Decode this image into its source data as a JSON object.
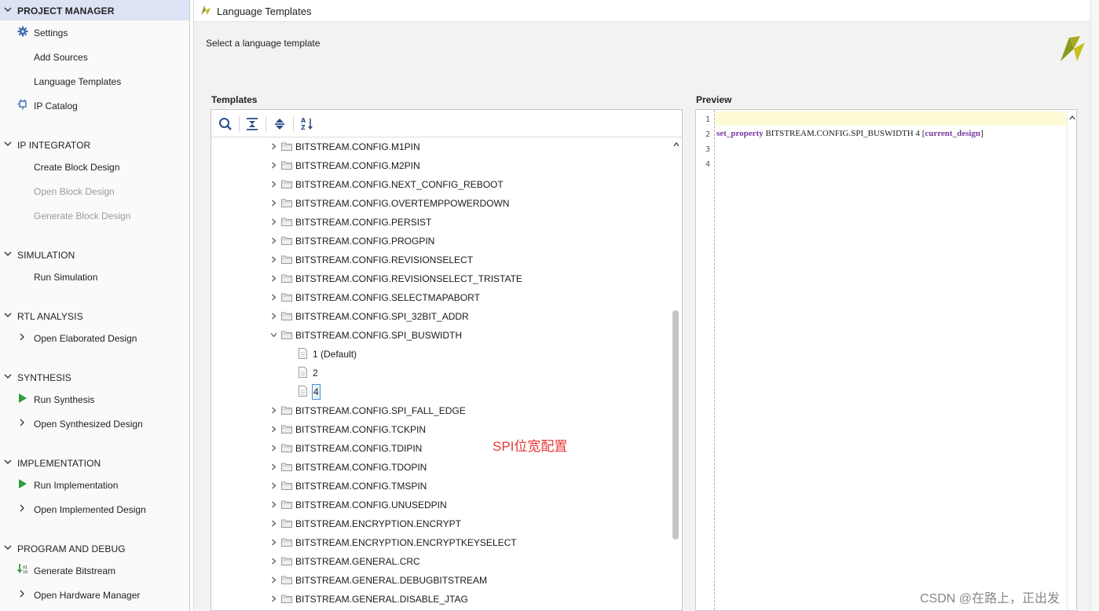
{
  "nav": {
    "sections": [
      {
        "title": "PROJECT MANAGER",
        "active": true,
        "items": [
          {
            "label": "Settings",
            "icon": "gear-icon",
            "disabled": false
          },
          {
            "label": "Add Sources",
            "icon": "",
            "disabled": false
          },
          {
            "label": "Language Templates",
            "icon": "",
            "disabled": false
          },
          {
            "label": "IP Catalog",
            "icon": "plug-icon",
            "disabled": false
          }
        ]
      },
      {
        "title": "IP INTEGRATOR",
        "active": false,
        "items": [
          {
            "label": "Create Block Design",
            "icon": "",
            "disabled": false
          },
          {
            "label": "Open Block Design",
            "icon": "",
            "disabled": true
          },
          {
            "label": "Generate Block Design",
            "icon": "",
            "disabled": true
          }
        ]
      },
      {
        "title": "SIMULATION",
        "active": false,
        "items": [
          {
            "label": "Run Simulation",
            "icon": "",
            "disabled": false
          }
        ]
      },
      {
        "title": "RTL ANALYSIS",
        "active": false,
        "items": [
          {
            "label": "Open Elaborated Design",
            "icon": "chevron-right-icon",
            "disabled": false
          }
        ]
      },
      {
        "title": "SYNTHESIS",
        "active": false,
        "items": [
          {
            "label": "Run Synthesis",
            "icon": "play-icon",
            "disabled": false
          },
          {
            "label": "Open Synthesized Design",
            "icon": "chevron-right-icon",
            "disabled": false
          }
        ]
      },
      {
        "title": "IMPLEMENTATION",
        "active": false,
        "items": [
          {
            "label": "Run Implementation",
            "icon": "play-icon",
            "disabled": false
          },
          {
            "label": "Open Implemented Design",
            "icon": "chevron-right-icon",
            "disabled": false
          }
        ]
      },
      {
        "title": "PROGRAM AND DEBUG",
        "active": false,
        "items": [
          {
            "label": "Generate Bitstream",
            "icon": "bitstream-icon",
            "disabled": false
          },
          {
            "label": "Open Hardware Manager",
            "icon": "chevron-right-icon",
            "disabled": false
          }
        ]
      }
    ]
  },
  "window": {
    "title": "Language Templates",
    "subtitle": "Select a language template"
  },
  "templates": {
    "label": "Templates",
    "toolbar": [
      "search-icon",
      "collapse-all-icon",
      "expand-all-icon",
      "sort-az-icon"
    ],
    "rows": [
      {
        "label": "BITSTREAM.CONFIG.M1PIN",
        "kind": "folder",
        "expanded": false
      },
      {
        "label": "BITSTREAM.CONFIG.M2PIN",
        "kind": "folder",
        "expanded": false
      },
      {
        "label": "BITSTREAM.CONFIG.NEXT_CONFIG_REBOOT",
        "kind": "folder",
        "expanded": false
      },
      {
        "label": "BITSTREAM.CONFIG.OVERTEMPPOWERDOWN",
        "kind": "folder",
        "expanded": false
      },
      {
        "label": "BITSTREAM.CONFIG.PERSIST",
        "kind": "folder",
        "expanded": false
      },
      {
        "label": "BITSTREAM.CONFIG.PROGPIN",
        "kind": "folder",
        "expanded": false
      },
      {
        "label": "BITSTREAM.CONFIG.REVISIONSELECT",
        "kind": "folder",
        "expanded": false
      },
      {
        "label": "BITSTREAM.CONFIG.REVISIONSELECT_TRISTATE",
        "kind": "folder",
        "expanded": false
      },
      {
        "label": "BITSTREAM.CONFIG.SELECTMAPABORT",
        "kind": "folder",
        "expanded": false
      },
      {
        "label": "BITSTREAM.CONFIG.SPI_32BIT_ADDR",
        "kind": "folder",
        "expanded": false
      },
      {
        "label": "BITSTREAM.CONFIG.SPI_BUSWIDTH",
        "kind": "folder",
        "expanded": true
      },
      {
        "label": "1 (Default)",
        "kind": "leaf",
        "selected": false
      },
      {
        "label": "2",
        "kind": "leaf",
        "selected": false
      },
      {
        "label": "4",
        "kind": "leaf",
        "selected": true
      },
      {
        "label": "BITSTREAM.CONFIG.SPI_FALL_EDGE",
        "kind": "folder",
        "expanded": false
      },
      {
        "label": "BITSTREAM.CONFIG.TCKPIN",
        "kind": "folder",
        "expanded": false
      },
      {
        "label": "BITSTREAM.CONFIG.TDIPIN",
        "kind": "folder",
        "expanded": false
      },
      {
        "label": "BITSTREAM.CONFIG.TDOPIN",
        "kind": "folder",
        "expanded": false
      },
      {
        "label": "BITSTREAM.CONFIG.TMSPIN",
        "kind": "folder",
        "expanded": false
      },
      {
        "label": "BITSTREAM.CONFIG.UNUSEDPIN",
        "kind": "folder",
        "expanded": false
      },
      {
        "label": "BITSTREAM.ENCRYPTION.ENCRYPT",
        "kind": "folder",
        "expanded": false
      },
      {
        "label": "BITSTREAM.ENCRYPTION.ENCRYPTKEYSELECT",
        "kind": "folder",
        "expanded": false
      },
      {
        "label": "BITSTREAM.GENERAL.CRC",
        "kind": "folder",
        "expanded": false
      },
      {
        "label": "BITSTREAM.GENERAL.DEBUGBITSTREAM",
        "kind": "folder",
        "expanded": false
      },
      {
        "label": "BITSTREAM.GENERAL.DISABLE_JTAG",
        "kind": "folder",
        "expanded": false
      }
    ],
    "annotation": "SPI位宽配置"
  },
  "preview": {
    "label": "Preview",
    "line_numbers": [
      "1",
      "2",
      "3",
      "4"
    ],
    "code": {
      "keyword": "set_property",
      "text": " BITSTREAM.CONFIG.SPI_BUSWIDTH 4 ",
      "open_bracket": "[",
      "command": "current_design",
      "close_bracket": "]"
    }
  },
  "watermark": "CSDN @在路上，正出发",
  "colors": {
    "active_section_bg": "#dce3f4",
    "run_green": "#2e9e3e",
    "annotation_red": "#e53935",
    "code_purple": "#7a3aa0",
    "current_line_bg": "#fdfbd6"
  }
}
